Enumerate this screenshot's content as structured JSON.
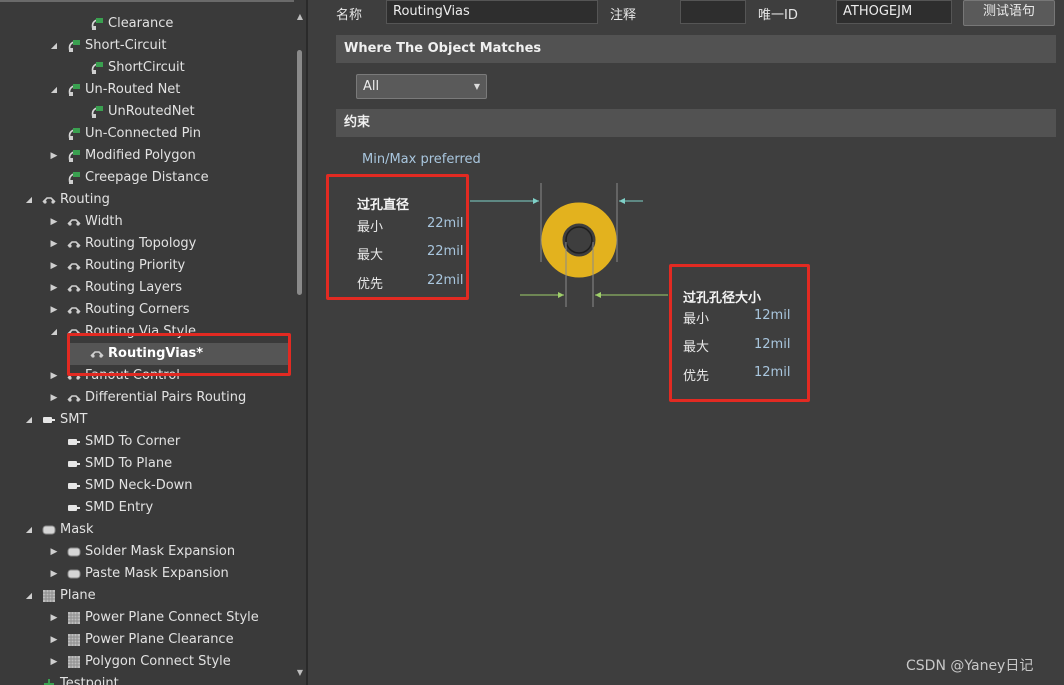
{
  "tree": {
    "rows": [
      {
        "label": "Clearance",
        "arrow": "",
        "icon": "rule-icon"
      },
      {
        "label": "Short-Circuit",
        "arrow": "down",
        "icon": "rule-icon"
      },
      {
        "label": "ShortCircuit",
        "arrow": "",
        "icon": "rule-icon"
      },
      {
        "label": "Un-Routed Net",
        "arrow": "down",
        "icon": "rule-icon"
      },
      {
        "label": "UnRoutedNet",
        "arrow": "",
        "icon": "rule-icon"
      },
      {
        "label": "Un-Connected Pin",
        "arrow": "",
        "icon": "rule-icon"
      },
      {
        "label": "Modified Polygon",
        "arrow": "right",
        "icon": "rule-icon"
      },
      {
        "label": "Creepage Distance",
        "arrow": "",
        "icon": "rule-icon"
      },
      {
        "label": "Routing",
        "arrow": "down",
        "icon": "routing-icon"
      },
      {
        "label": "Width",
        "arrow": "right",
        "icon": "routing-icon"
      },
      {
        "label": "Routing Topology",
        "arrow": "right",
        "icon": "routing-icon"
      },
      {
        "label": "Routing Priority",
        "arrow": "right",
        "icon": "routing-icon"
      },
      {
        "label": "Routing Layers",
        "arrow": "right",
        "icon": "routing-icon"
      },
      {
        "label": "Routing Corners",
        "arrow": "right",
        "icon": "routing-icon"
      },
      {
        "label": "Routing Via Style",
        "arrow": "down",
        "icon": "routing-icon"
      },
      {
        "label": "RoutingVias*",
        "arrow": "",
        "icon": "routing-icon",
        "selected": true
      },
      {
        "label": "Fanout Control",
        "arrow": "right",
        "icon": "routing-icon"
      },
      {
        "label": "Differential Pairs Routing",
        "arrow": "right",
        "icon": "routing-icon"
      },
      {
        "label": "SMT",
        "arrow": "down",
        "icon": "smt-icon"
      },
      {
        "label": "SMD To Corner",
        "arrow": "",
        "icon": "smt-icon"
      },
      {
        "label": "SMD To Plane",
        "arrow": "",
        "icon": "smt-icon"
      },
      {
        "label": "SMD Neck-Down",
        "arrow": "",
        "icon": "smt-icon"
      },
      {
        "label": "SMD Entry",
        "arrow": "",
        "icon": "smt-icon"
      },
      {
        "label": "Mask",
        "arrow": "down",
        "icon": "mask-icon"
      },
      {
        "label": "Solder Mask Expansion",
        "arrow": "right",
        "icon": "mask-icon"
      },
      {
        "label": "Paste Mask Expansion",
        "arrow": "right",
        "icon": "mask-icon"
      },
      {
        "label": "Plane",
        "arrow": "down",
        "icon": "plane-icon"
      },
      {
        "label": "Power Plane Connect Style",
        "arrow": "right",
        "icon": "plane-icon"
      },
      {
        "label": "Power Plane Clearance",
        "arrow": "right",
        "icon": "plane-icon"
      },
      {
        "label": "Polygon Connect Style",
        "arrow": "right",
        "icon": "plane-icon"
      },
      {
        "label": "Testpoint",
        "arrow": "",
        "icon": "testpoint-icon"
      }
    ]
  },
  "header": {
    "name_label": "名称",
    "name_value": "RoutingVias",
    "comment_label": "注释",
    "comment_value": "",
    "uid_label": "唯一ID",
    "uid_value": "ATHOGEJM",
    "test_button": "测试语句"
  },
  "where": {
    "title": "Where The Object Matches",
    "scope_value": "All"
  },
  "constraints": {
    "title": "约束",
    "mode_label": "Min/Max preferred",
    "via_diameter": {
      "title": "过孔直径",
      "min_label": "最小",
      "min_value": "22mil",
      "max_label": "最大",
      "max_value": "22mil",
      "pref_label": "优先",
      "pref_value": "22mil"
    },
    "via_hole": {
      "title": "过孔孔径大小",
      "min_label": "最小",
      "min_value": "12mil",
      "max_label": "最大",
      "max_value": "12mil",
      "pref_label": "优先",
      "pref_value": "12mil"
    }
  },
  "colors": {
    "via_ring": "#e3b21e",
    "diameter_arrow": "#7fd1c8",
    "hole_arrow": "#9fcf6a",
    "highlight": "#e22a22"
  },
  "watermark": "CSDN @Yaney日记"
}
